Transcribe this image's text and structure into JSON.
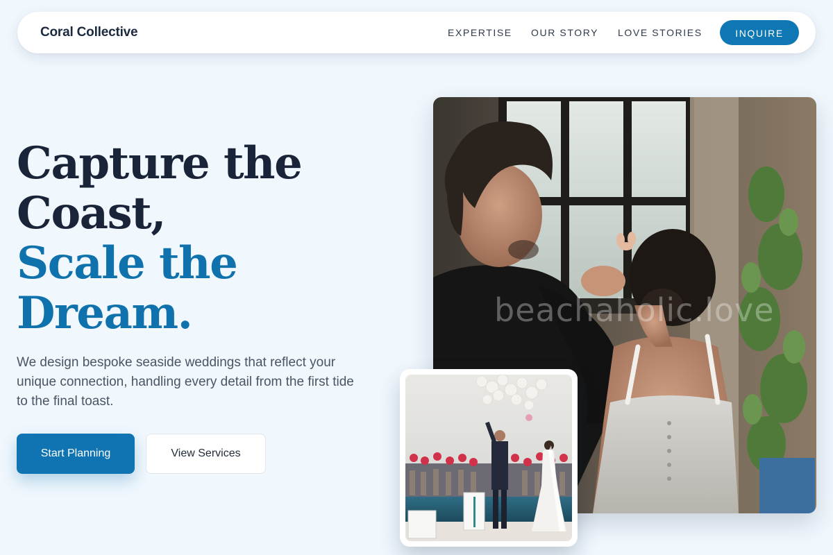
{
  "nav": {
    "brand": "Coral Collective",
    "links": [
      {
        "label": "EXPERTISE"
      },
      {
        "label": "OUR STORY"
      },
      {
        "label": "LOVE STORIES"
      }
    ],
    "cta_label": "INQUIRE"
  },
  "hero": {
    "headline_line_1": "Capture the",
    "headline_line_2": "Coast,",
    "headline_line_3": "Scale the",
    "headline_line_4": "Dream.",
    "description": "We design bespoke seaside weddings that reflect your unique connection, handling every detail from the first tide to the final toast.",
    "primary_button": "Start Planning",
    "secondary_button": "View Services"
  },
  "media": {
    "main_photo_watermark": "beachaholic.love",
    "main_photo_subject": "groom adjusting bride's hair beside window",
    "inset_photo_subject": "couple releasing balloons at poolside wedding"
  },
  "colors": {
    "page_background": "#f0f7fd",
    "heading_dark": "#1a2438",
    "accent_blue": "#0f74b1",
    "body_text": "#4a5563"
  }
}
